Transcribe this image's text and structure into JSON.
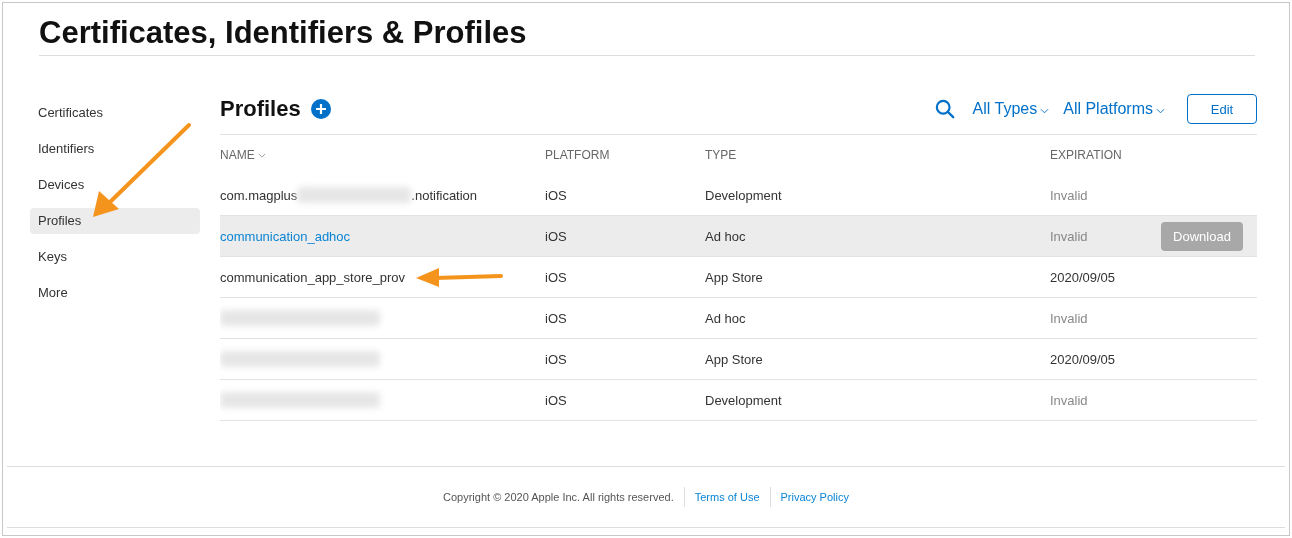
{
  "page_title": "Certificates, Identifiers & Profiles",
  "sidebar": {
    "items": [
      {
        "label": "Certificates",
        "selected": false
      },
      {
        "label": "Identifiers",
        "selected": false
      },
      {
        "label": "Devices",
        "selected": false
      },
      {
        "label": "Profiles",
        "selected": true
      },
      {
        "label": "Keys",
        "selected": false
      },
      {
        "label": "More",
        "selected": false
      }
    ]
  },
  "section": {
    "title": "Profiles",
    "filters": [
      "All Types",
      "All Platforms"
    ],
    "edit_button": "Edit"
  },
  "table": {
    "columns": [
      "NAME",
      "PLATFORM",
      "TYPE",
      "EXPIRATION"
    ],
    "rows": [
      {
        "name_start": "com.magplus",
        "name_redacted": true,
        "name_end": ".notification",
        "platform": "iOS",
        "type": "Development",
        "expiration": "Invalid",
        "invalid": true,
        "selected": false
      },
      {
        "name_start": "communication_adhoc",
        "name_redacted": false,
        "platform": "iOS",
        "type": "Ad hoc",
        "expiration": "Invalid",
        "invalid": true,
        "selected": true,
        "action": "Download"
      },
      {
        "name_start": "communication_app_store_prov",
        "name_redacted": false,
        "platform": "iOS",
        "type": "App Store",
        "expiration": "2020/09/05",
        "invalid": false,
        "selected": false
      },
      {
        "name_redacted": true,
        "platform": "iOS",
        "type": "Ad hoc",
        "expiration": "Invalid",
        "invalid": true,
        "selected": false
      },
      {
        "name_redacted": true,
        "platform": "iOS",
        "type": "App Store",
        "expiration": "2020/09/05",
        "invalid": false,
        "selected": false
      },
      {
        "name_redacted": true,
        "platform": "iOS",
        "type": "Development",
        "expiration": "Invalid",
        "invalid": true,
        "selected": false
      }
    ]
  },
  "footer": {
    "copyright": "Copyright © 2020 Apple Inc. All rights reserved.",
    "links": [
      "Terms of Use",
      "Privacy Policy"
    ]
  }
}
